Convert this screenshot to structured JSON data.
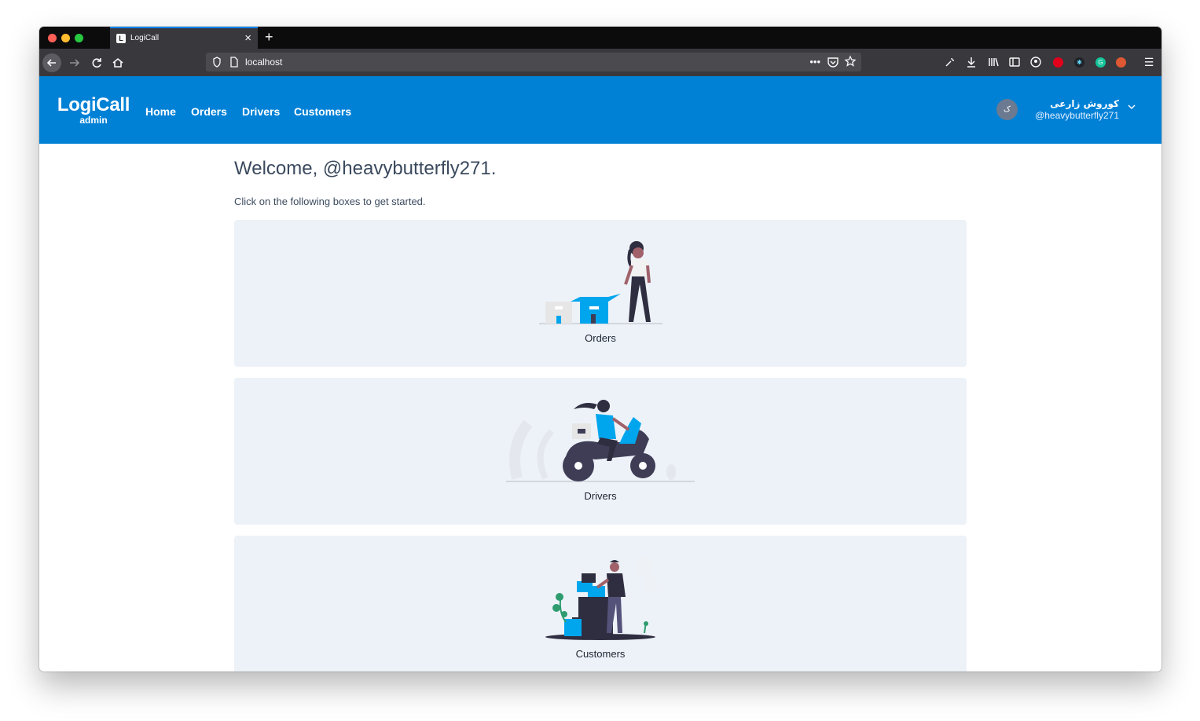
{
  "browser": {
    "tab_title": "LogiCall",
    "tab_favicon": "L",
    "url": "localhost",
    "icons": {
      "back": "arrow-left-icon",
      "forward": "arrow-right-icon",
      "reload": "reload-icon",
      "home": "home-icon",
      "shield": "shield-icon",
      "page": "page-icon",
      "more": "more-icon",
      "pocket": "pocket-icon",
      "bookmark": "star-icon"
    }
  },
  "header": {
    "brand": "LogiCall",
    "brand_sub": "admin",
    "nav": [
      {
        "label": "Home"
      },
      {
        "label": "Orders"
      },
      {
        "label": "Drivers"
      },
      {
        "label": "Customers"
      }
    ],
    "user": {
      "avatar_initial": "ک",
      "name": "کوروش زارعی",
      "handle": "@heavybutterfly271"
    }
  },
  "main": {
    "welcome": "Welcome, @heavybutterfly271.",
    "intro": "Click on the following boxes to get started.",
    "cards": [
      {
        "label": "Orders"
      },
      {
        "label": "Drivers"
      },
      {
        "label": "Customers"
      }
    ]
  },
  "colors": {
    "brand_blue": "#0081d6",
    "card_bg": "#edf2f8",
    "accent_illustration": "#00a6ed",
    "dark_illustration": "#3f3d56"
  }
}
